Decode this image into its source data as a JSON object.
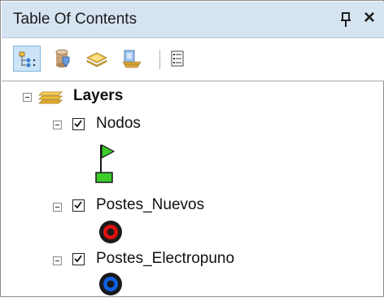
{
  "panel": {
    "title": "Table Of Contents",
    "pin_icon": "pin-icon",
    "close_label": "×"
  },
  "toolbar": {
    "buttons": [
      {
        "name": "list-by-drawing-order",
        "icon": "layers-tree-icon",
        "active": true
      },
      {
        "name": "list-by-source",
        "icon": "database-icon",
        "active": false
      },
      {
        "name": "list-by-visibility",
        "icon": "layer-stack-icon",
        "active": false
      },
      {
        "name": "list-by-selection",
        "icon": "selection-icon",
        "active": false
      },
      {
        "name": "options",
        "icon": "options-list-icon",
        "active": false
      }
    ]
  },
  "tree": {
    "root": {
      "label": "Layers",
      "icon": "layers-icon",
      "expanded": true
    },
    "layers": [
      {
        "label": "Nodos",
        "checked": true,
        "expanded": true,
        "symbol": "green-flag-icon",
        "symbol_colors": {
          "fill": "#3ccc2a",
          "stroke": "#1a1a1a"
        }
      },
      {
        "label": "Postes_Nuevos",
        "checked": true,
        "expanded": true,
        "symbol": "red-circle-icon",
        "symbol_colors": {
          "fill": "#e01010",
          "stroke": "#1a1a1a"
        }
      },
      {
        "label": "Postes_Electropuno",
        "checked": true,
        "expanded": true,
        "symbol": "blue-circle-icon",
        "symbol_colors": {
          "fill": "#1060e0",
          "stroke": "#1a1a1a"
        }
      }
    ]
  }
}
